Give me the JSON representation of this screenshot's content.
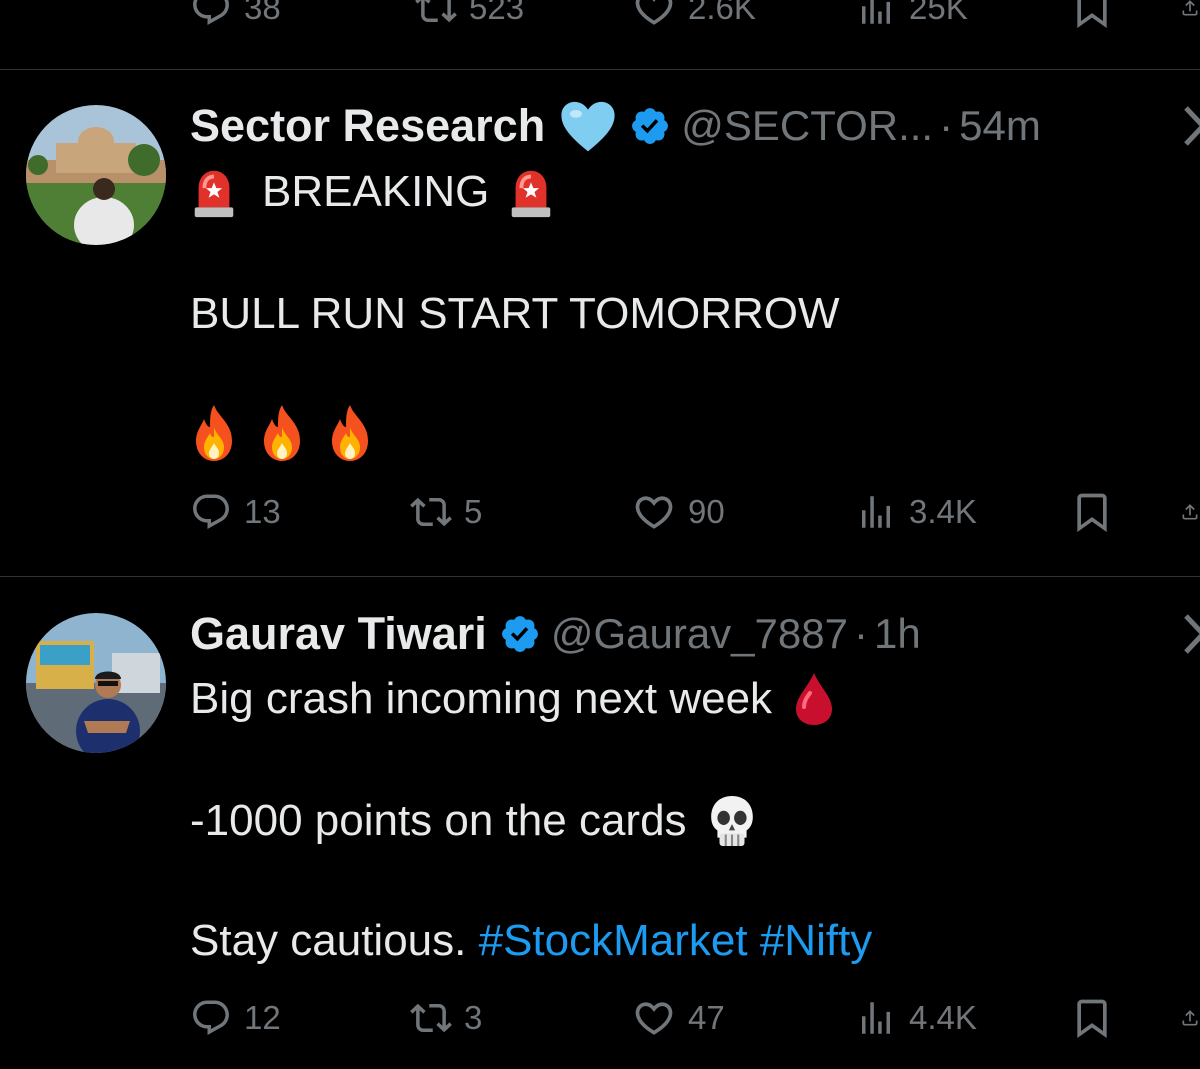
{
  "previous_tweet": {
    "actions": {
      "replies": "38",
      "reposts": "523",
      "likes": "2.6K",
      "views": "25K"
    }
  },
  "tweets": [
    {
      "author_name": "Sector Research",
      "handle": "@SECTOR...",
      "separator": "·",
      "time": "54m",
      "headline": "BREAKING",
      "line2": "BULL RUN START TOMORROW",
      "actions": {
        "replies": "13",
        "reposts": "5",
        "likes": "90",
        "views": "3.4K"
      }
    },
    {
      "author_name": "Gaurav Tiwari",
      "handle": "@Gaurav_7887",
      "separator": "·",
      "time": "1h",
      "line1": "Big crash incoming next week",
      "line2": "-1000 points on the cards",
      "line3_text": "Stay cautious.",
      "hashtags": [
        "#StockMarket",
        "#Nifty"
      ],
      "actions": {
        "replies": "12",
        "reposts": "3",
        "likes": "47",
        "views": "4.4K"
      }
    }
  ],
  "colors": {
    "background": "#000000",
    "text": "#e7e9ea",
    "muted": "#71767b",
    "link": "#1d9bf0",
    "divider": "#2f3336",
    "verified": "#1d9bf0"
  },
  "icons": [
    "reply-icon",
    "repost-icon",
    "like-icon",
    "views-icon",
    "bookmark-icon",
    "share-icon",
    "verified-badge-icon",
    "blue-heart-emoji",
    "siren-emoji",
    "fire-emoji",
    "drop-of-blood-emoji",
    "skull-emoji",
    "more-icon"
  ]
}
